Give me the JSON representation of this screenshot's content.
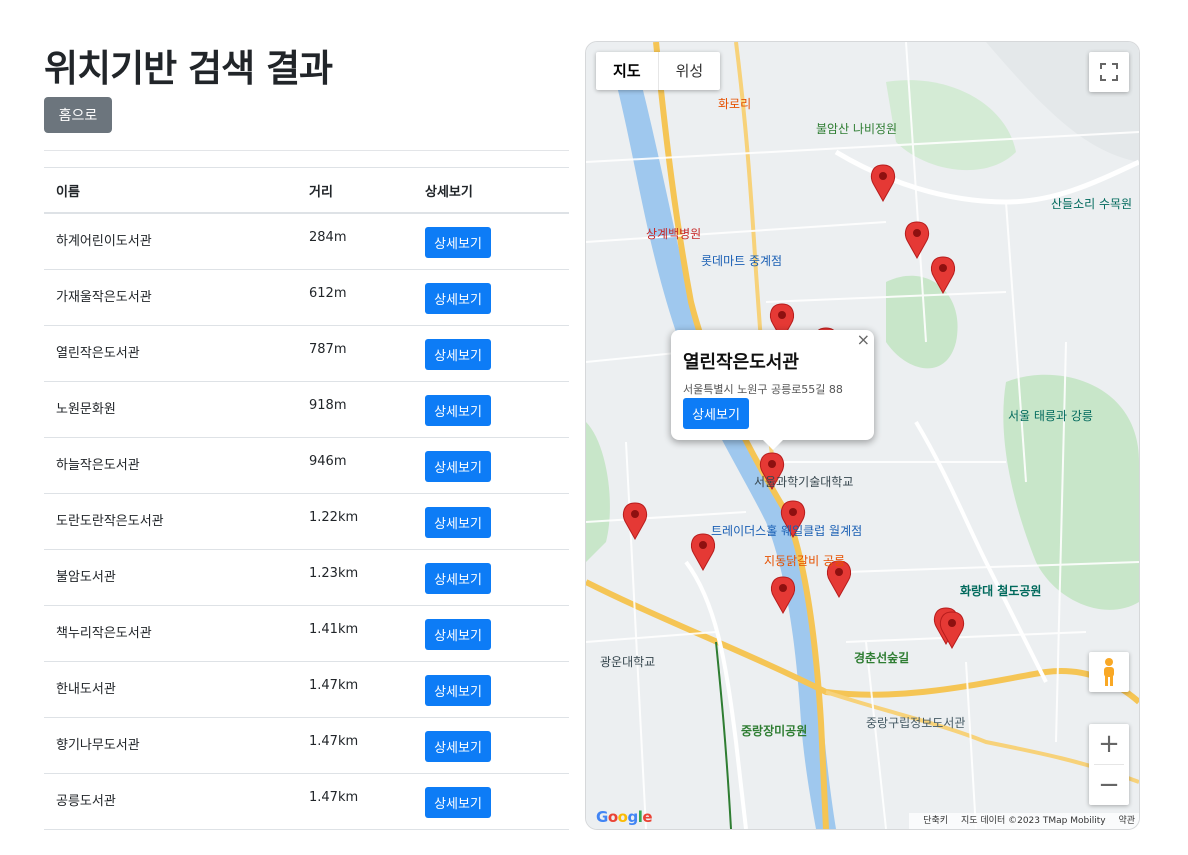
{
  "page": {
    "title": "위치기반 검색 결과",
    "home_label": "홈으로"
  },
  "table": {
    "headers": {
      "name": "이름",
      "distance": "거리",
      "detail": "상세보기"
    },
    "rows": [
      {
        "name": "하계어린이도서관",
        "distance": "284m",
        "button": "상세보기"
      },
      {
        "name": "가재울작은도서관",
        "distance": "612m",
        "button": "상세보기"
      },
      {
        "name": "열린작은도서관",
        "distance": "787m",
        "button": "상세보기"
      },
      {
        "name": "노원문화원",
        "distance": "918m",
        "button": "상세보기"
      },
      {
        "name": "하늘작은도서관",
        "distance": "946m",
        "button": "상세보기"
      },
      {
        "name": "도란도란작은도서관",
        "distance": "1.22km",
        "button": "상세보기"
      },
      {
        "name": "불암도서관",
        "distance": "1.23km",
        "button": "상세보기"
      },
      {
        "name": "책누리작은도서관",
        "distance": "1.41km",
        "button": "상세보기"
      },
      {
        "name": "한내도서관",
        "distance": "1.47km",
        "button": "상세보기"
      },
      {
        "name": "향기나무도서관",
        "distance": "1.47km",
        "button": "상세보기"
      },
      {
        "name": "공릉도서관",
        "distance": "1.47km",
        "button": "상세보기"
      }
    ]
  },
  "map": {
    "type_buttons": {
      "map": "지도",
      "satellite": "위성"
    },
    "info_window": {
      "title": "열린작은도서관",
      "address": "서울특별시 노원구 공릉로55길 88",
      "button": "상세보기"
    },
    "labels": {
      "bulamsan": "불암산 나비정원",
      "lotte": "롯데마트 중계점",
      "hospital": "상계백병원",
      "school": "서울과학기술대학교",
      "park": "경춘선숲길",
      "station": "화랑대 철도공원",
      "rose": "중랑장미공원",
      "kwangwoon": "광운대학교",
      "taereung": "서울 태릉과 강릉",
      "sandle": "산들소리 수목원",
      "horori": "화로리",
      "junglang_lib": "중랑구립정보도서관",
      "tray": "트레이더스홀 웨일클럽 월계점",
      "jidong": "지동닭갈비 공릉"
    },
    "google_logo": "Google",
    "attribution": {
      "shortcuts": "단축키",
      "data": "지도 데이터 ©2023 TMap Mobility",
      "terms": "약관"
    }
  },
  "colors": {
    "primary_button": "#0d7cf6",
    "secondary_button": "#6c757d",
    "marker": "#e53935",
    "road_major": "#f5c555",
    "water": "#8ec2f0",
    "park": "#bfe3c4"
  },
  "icons": {
    "fullscreen": "fullscreen-icon",
    "pegman": "pegman-icon",
    "zoom_in": "plus-icon",
    "zoom_out": "minus-icon"
  }
}
